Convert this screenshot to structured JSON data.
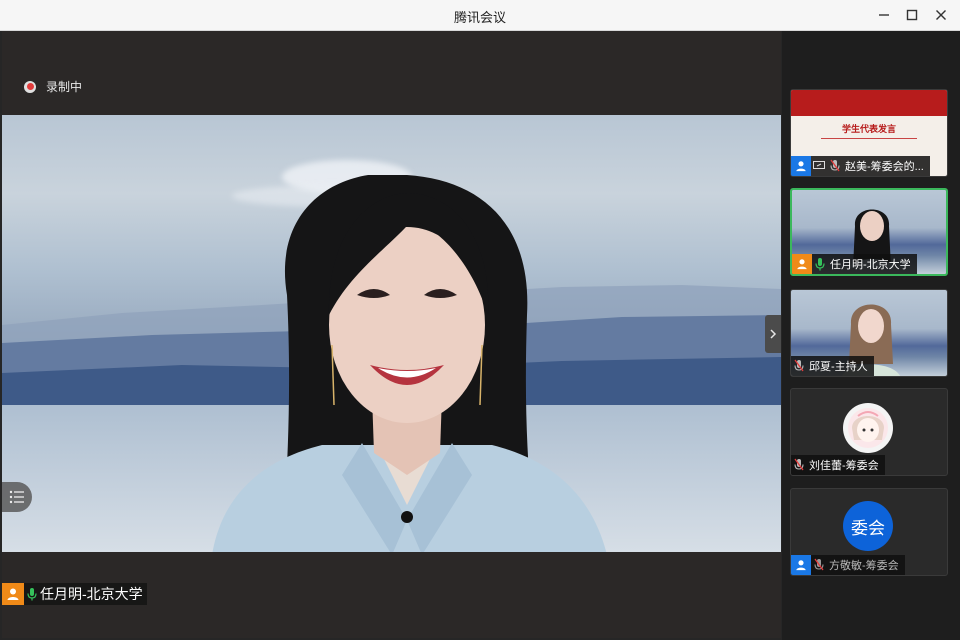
{
  "window": {
    "title": "腾讯会议"
  },
  "recording": {
    "label": "录制中"
  },
  "main_speaker": {
    "name": "任月明-北京大学"
  },
  "participants": [
    {
      "name": "赵美-筹委会的...",
      "type": "screen-share",
      "slide_title": "学生代表发言"
    },
    {
      "name": "任月明-北京大学",
      "type": "video",
      "active": true
    },
    {
      "name": "邱夏-主持人",
      "type": "video"
    },
    {
      "name": "刘佳蕾-筹委会",
      "type": "avatar"
    },
    {
      "name": "方敬敏-筹委会",
      "type": "avatar",
      "avatar_text": "委会"
    }
  ],
  "colors": {
    "active_border": "#3bb85c",
    "orange_badge": "#f08a18",
    "blue_badge": "#1a78e6",
    "record_red": "#e23c3c"
  }
}
